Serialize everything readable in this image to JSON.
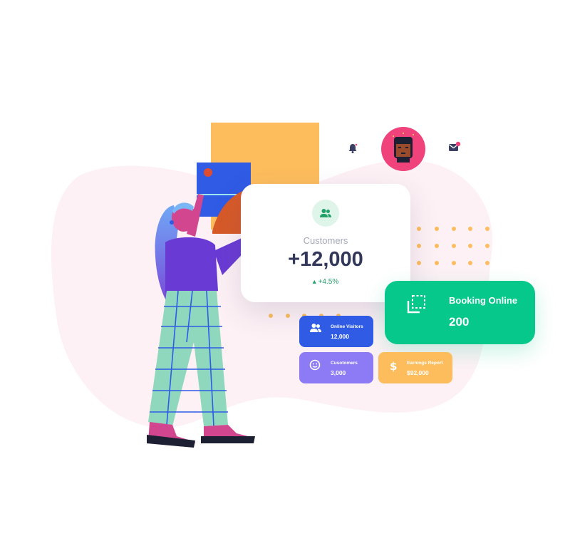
{
  "colors": {
    "accent_green": "#05c88a",
    "accent_blue": "#2f5be5",
    "accent_purple": "#8d7bf5",
    "accent_yellow": "#fdbd5d",
    "avatar_pink": "#f0437c",
    "text_dark": "#33385a"
  },
  "header": {
    "notification_icon": "bell-icon",
    "message_icon": "mail-icon",
    "avatar_icon": "user-avatar"
  },
  "customers_card": {
    "icon": "users-icon",
    "label": "Customers",
    "value": "+12,000",
    "change": "+4.5%"
  },
  "booking_card": {
    "icon": "selection-icon",
    "label": "Booking Online",
    "value": "200"
  },
  "mini_cards": [
    {
      "icon": "users-icon",
      "title": "Online Visitors",
      "value": "12,000"
    },
    {
      "icon": "smile-icon",
      "title": "Cusotomers",
      "value": "3,000"
    },
    {
      "icon": "dollar-icon",
      "title": "Earnings Report",
      "value": "$92,000"
    }
  ]
}
